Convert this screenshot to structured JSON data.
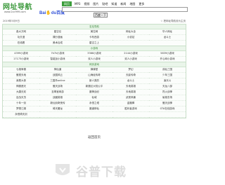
{
  "site": {
    "logo_text": "网址导航",
    "logo_sub": "www.2cc999.com",
    "baidu_text": "Bai",
    "baidu_paw": "du",
    "baidu_suffix": "百度"
  },
  "search": {
    "tabs": [
      "网页",
      "MP3",
      "视频",
      "图片",
      "贴吧",
      "知道",
      "新闻",
      "地图",
      "更多"
    ],
    "active_tab": "网页",
    "value": "",
    "button_label": "百度一下"
  },
  "topbar": {
    "date_text": "2019年5月9日",
    "sethome_text": "☆ 把网址导航设为主页"
  },
  "sections": [
    {
      "title": "名站导航",
      "items": [
        "各大万网",
        "星空论",
        "美拉网",
        "网址大全",
        "华人网址",
        "功夫漫",
        "裸分漫画",
        "卡布西游",
        "小说站",
        "龙斗士",
        "在线看",
        "美术合成",
        "星空之上",
        "",
        ""
      ]
    },
    {
      "title": "小游戏",
      "items": [
        "4399小游戏",
        "7k7k小游戏",
        "3366小游戏",
        "2144小游戏",
        "5839小游戏",
        "17173小游戏",
        "智能加小游戏",
        "双人小游戏",
        "双人小游戏",
        "开心网小游戏"
      ]
    },
    {
      "title": "网页游戏",
      "items": [
        "七雄争霸",
        "神仙道",
        "弹弹堂",
        "梦幻",
        "诛仙三国",
        "傲视天地",
        "战国风云",
        "山海经传奇",
        "天影传奇",
        "少年三国",
        "我是大侠",
        "三国杀online",
        "新人类的",
        "龙斗士",
        "凌天斗",
        "神魔遮天",
        "傲天战场",
        "新魔幻大陆公平",
        "天地英雄",
        "天龙八部",
        "大唐无双",
        "至尊宝网游",
        "魔神战纪",
        "天地英雄",
        "烈火战神",
        "百战天虫",
        "战國英雄",
        "仙域",
        "武侠风暴",
        "偷菜农场",
        "十年一剑",
        "新仙剑奇侠传",
        "永恒之塔",
        "金箍棒",
        "傲天战神",
        "梦想江湖",
        "倚天屠龙",
        "魔道修仙",
        "胜利者游戏",
        "GTA在线游戏",
        "永恒倚天剑",
        "",
        "",
        "",
        ""
      ]
    }
  ],
  "back_label": "返回首页",
  "watermark": {
    "text": "谷普下载"
  }
}
